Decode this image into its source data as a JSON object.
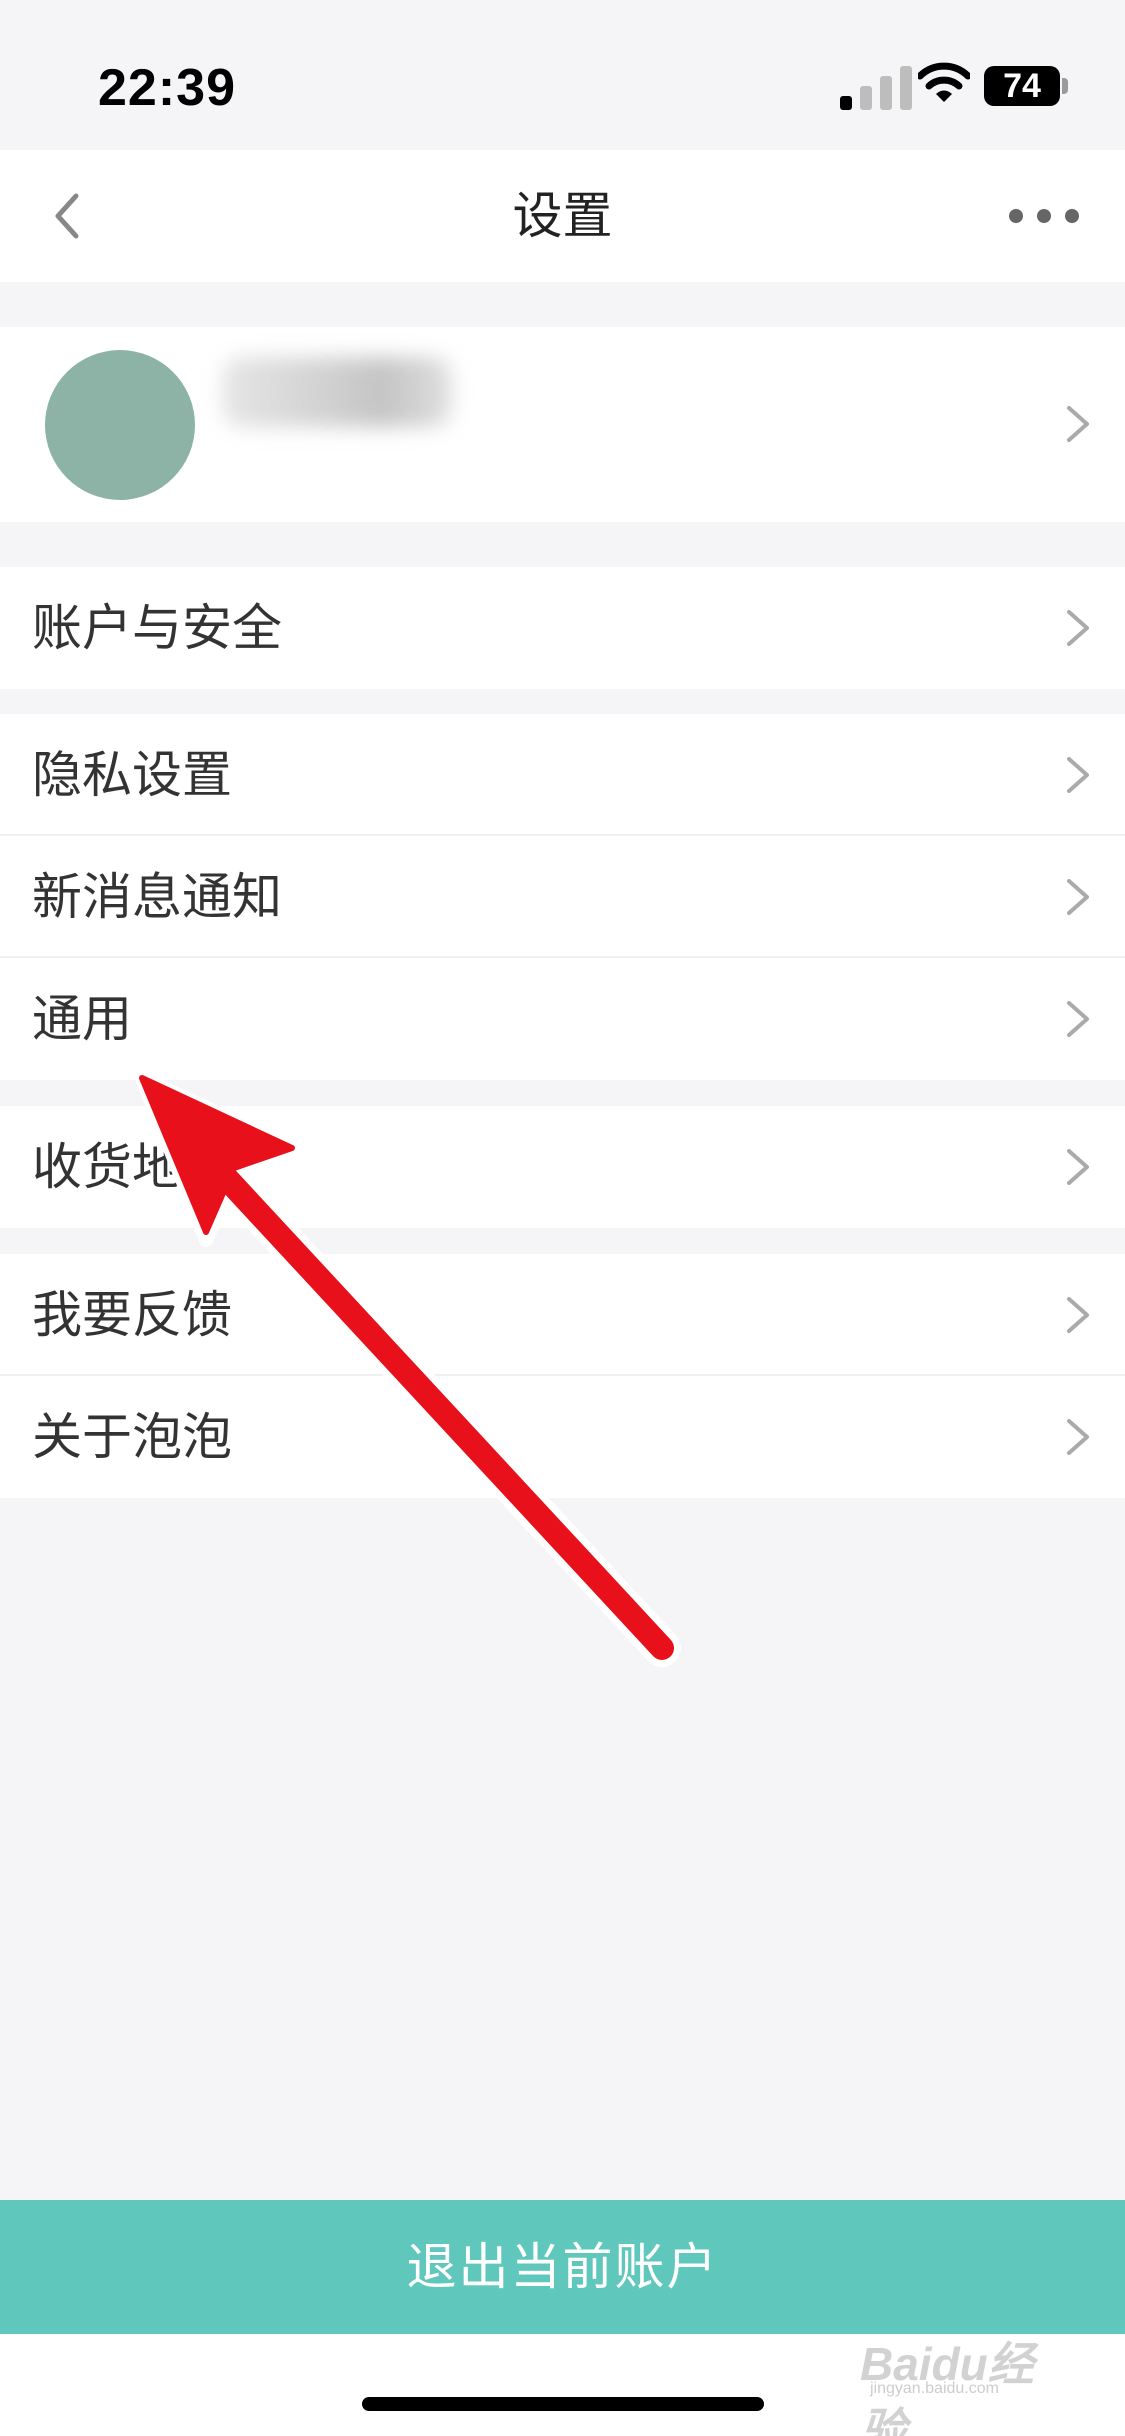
{
  "status_bar": {
    "time": "22:39",
    "battery": "74",
    "icons": [
      "signal-icon",
      "wifi-icon",
      "battery-icon"
    ]
  },
  "nav": {
    "title": "设置",
    "back_icon": "chevron-left-icon",
    "more_icon": "more-dots-icon"
  },
  "profile": {
    "avatar_color": "#8db3a6"
  },
  "menu": {
    "groups": [
      [
        {
          "label": "账户与安全"
        }
      ],
      [
        {
          "label": "隐私设置"
        },
        {
          "label": "新消息通知"
        },
        {
          "label": "通用"
        }
      ],
      [
        {
          "label": "收货地"
        }
      ],
      [
        {
          "label": "我要反馈"
        },
        {
          "label": "关于泡泡"
        }
      ]
    ]
  },
  "logout": {
    "label": "退出当前账户",
    "color": "#5fc7bb"
  },
  "annotation": {
    "arrow_color": "#e8101a"
  },
  "watermark": {
    "brand": "Baidu经验",
    "site": "jingyan.baidu.com"
  }
}
